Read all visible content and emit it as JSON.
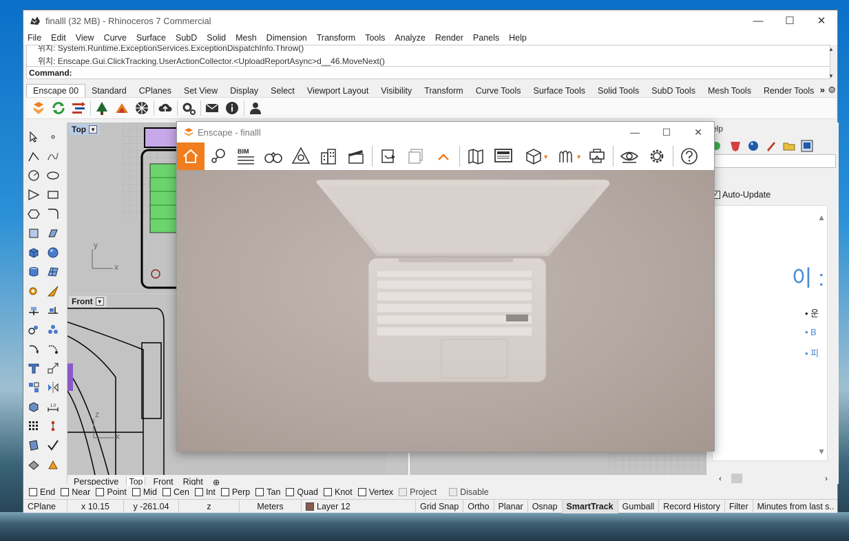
{
  "rhino": {
    "title": "finalll (32 MB) - Rhinoceros 7 Commercial",
    "window_controls": [
      "—",
      "☐",
      "✕"
    ],
    "menu": [
      "File",
      "Edit",
      "View",
      "Curve",
      "Surface",
      "SubD",
      "Solid",
      "Mesh",
      "Dimension",
      "Transform",
      "Tools",
      "Analyze",
      "Render",
      "Panels",
      "Help"
    ],
    "history": {
      "line1": "위치: System.Runtime.ExceptionServices.ExceptionDispatchInfo.Throw()",
      "line2": "위치: Enscape.Gui.ClickTracking.UserActionCollector.<UploadReportAsync>d__46.MoveNext()"
    },
    "command_label": "Command:",
    "tabs": [
      "Enscape 00",
      "Standard",
      "CPlanes",
      "Set View",
      "Display",
      "Select",
      "Viewport Layout",
      "Visibility",
      "Transform",
      "Curve Tools",
      "Surface Tools",
      "Solid Tools",
      "SubD Tools",
      "Mesh Tools",
      "Render Tools"
    ],
    "tabs_more": "»",
    "viewports": {
      "top_label": "Top",
      "front_label": "Front",
      "axis_y": "y",
      "axis_x": "x",
      "axis_z": "z",
      "axis_x2": "x"
    },
    "viewport_tabs": [
      "Perspective",
      "Top",
      "Front",
      "Right"
    ],
    "viewport_tabs_add": "⊕",
    "right_panel": {
      "header": "elp",
      "auto_update": "Auto-Update",
      "big_text": "이 :",
      "bullets": [
        "운",
        "B",
        "피"
      ]
    },
    "osnap": [
      {
        "label": "End",
        "disabled": false
      },
      {
        "label": "Near",
        "disabled": false
      },
      {
        "label": "Point",
        "disabled": false
      },
      {
        "label": "Mid",
        "disabled": false
      },
      {
        "label": "Cen",
        "disabled": false
      },
      {
        "label": "Int",
        "disabled": false
      },
      {
        "label": "Perp",
        "disabled": false
      },
      {
        "label": "Tan",
        "disabled": false
      },
      {
        "label": "Quad",
        "disabled": false
      },
      {
        "label": "Knot",
        "disabled": false
      },
      {
        "label": "Vertex",
        "disabled": false
      },
      {
        "label": "Project",
        "disabled": true
      },
      {
        "label": "Disable",
        "disabled": true
      }
    ],
    "status": {
      "cplane": "CPlane",
      "x": "x 10.15",
      "y": "y -261.04",
      "z": "z",
      "units": "Meters",
      "layer": "Layer 12",
      "grid_snap": "Grid Snap",
      "ortho": "Ortho",
      "planar": "Planar",
      "osnap": "Osnap",
      "smarttrack": "SmartTrack",
      "gumball": "Gumball",
      "record_history": "Record History",
      "filter": "Filter",
      "minutes": "Minutes from last s..."
    },
    "layer_color": "#8a5a50"
  },
  "enscape": {
    "title": "Enscape - finalll",
    "window_controls": [
      "—",
      "☐",
      "✕"
    ],
    "bim_label": "BIM",
    "accent_color": "#f07d1e"
  }
}
